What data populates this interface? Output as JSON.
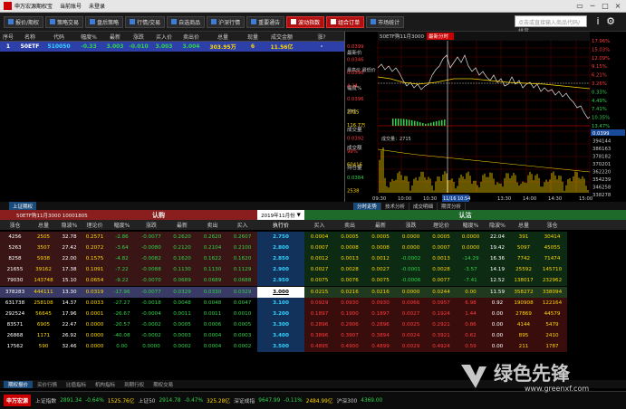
{
  "window": {
    "title": "申万宏源期权宝",
    "account": "当前账号",
    "user": "未登录",
    "controls": [
      "▭",
      "─",
      "□",
      "×"
    ]
  },
  "toolbar": [
    {
      "label": "报价/期权",
      "red": false
    },
    {
      "label": "策略交易",
      "red": false
    },
    {
      "label": "盘后策略",
      "red": false
    },
    {
      "label": "行情/交易",
      "red": false
    },
    {
      "label": "自选商品",
      "red": false
    },
    {
      "label": "沪深行情",
      "red": false
    },
    {
      "label": "重要通告",
      "red": false
    },
    {
      "label": "波动指数",
      "red": true
    },
    {
      "label": "组合订单",
      "red": true
    },
    {
      "label": "市场统计",
      "red": false
    }
  ],
  "search": {
    "placeholder": "点击或直接输入商品代码/拼音"
  },
  "toolbar_icons": [
    "i",
    "⚙"
  ],
  "etf": {
    "headers": [
      "序号",
      "名称",
      "代码",
      "幅度%",
      "最新",
      "涨跌",
      "买入价",
      "卖出价",
      "总量",
      "现量",
      "成交金额",
      "涨?"
    ],
    "row": [
      "1",
      "50ETF",
      "510050",
      "-0.33",
      "3.003",
      "-0.010",
      "3.003",
      "3.004",
      "303.95万",
      "6",
      "11.56亿",
      "-"
    ]
  },
  "chart": {
    "title": "50ETF购11月3000",
    "title2": "最新分时",
    "latest": "最新价",
    "hilo": "最高价 最低价",
    "avg_lbl": "均价",
    "vol_lbl": "成交量",
    "amt_lbl": "成交额",
    "pos_lbl": "持仓量",
    "vol_note": "成交量：2715",
    "change_lbl": "幅度%",
    "volume_val": "2715",
    "time_cursor": "11/16 10:54",
    "left_vals": [
      "0.0399",
      "0.0346",
      "0.0396",
      "4.24",
      "0.0396",
      "2715",
      "116.7万",
      "0.0392",
      "99%",
      "60416",
      "0.0384",
      "2538"
    ],
    "right_pct": [
      "17.96%",
      "15.03%",
      "12.09%",
      "9.15%",
      "6.21%",
      "3.26%",
      "0.33%",
      "4.49%",
      "7.41%",
      "10.35%",
      "13.47%"
    ],
    "right_vals": [
      "0.0399",
      "394144",
      "386163",
      "378182",
      "370201",
      "362220",
      "354239",
      "346258",
      "338278"
    ],
    "times": [
      "09:30",
      "10:00",
      "10:30",
      "11:16 10:54",
      "13:30",
      "14:00",
      "14:30",
      "15:00"
    ]
  },
  "tabs_right": [
    "分时走势",
    "技术分析",
    "成交明细",
    "期货分析"
  ],
  "mid_tab": "上证期权",
  "option": {
    "underlying_title": "50ETF购11月3000  10001805",
    "call_title": "认购",
    "put_title": "认沽",
    "month": "2019年11月份",
    "call_headers": [
      "涨仓",
      "总量",
      "隐波%",
      "理论价",
      "幅度%",
      "涨跌",
      "最新",
      "卖出",
      "买入"
    ],
    "strike_header": "执行价",
    "put_headers": [
      "买入",
      "卖出",
      "最新",
      "涨跌",
      "理论价",
      "幅度%",
      "隐波%",
      "总量",
      "涨仓"
    ],
    "rows": [
      {
        "c": [
          "4256",
          "2505",
          "32.78",
          "0.2571",
          "-2.86",
          "-0.0077",
          "0.2620",
          "0.2620",
          "0.2607"
        ],
        "k": "2.750",
        "p": [
          "0.0004",
          "0.0005",
          "0.0005",
          "0.0000",
          "0.0005",
          "0.0000",
          "22.04",
          "391",
          "30414"
        ]
      },
      {
        "c": [
          "5263",
          "3507",
          "27.42",
          "0.2072",
          "-3.64",
          "-0.0080",
          "0.2120",
          "0.2104",
          "0.2100"
        ],
        "k": "2.800",
        "p": [
          "0.0007",
          "0.0008",
          "0.0008",
          "0.0000",
          "0.0007",
          "0.0000",
          "19.42",
          "5097",
          "45055"
        ]
      },
      {
        "c": [
          "8258",
          "5938",
          "22.00",
          "0.1575",
          "-4.82",
          "-0.0082",
          "0.1620",
          "0.1622",
          "0.1620"
        ],
        "k": "2.850",
        "p": [
          "0.0012",
          "0.0013",
          "0.0012",
          "-0.0002",
          "0.0013",
          "-14.29",
          "16.36",
          "7742",
          "71474"
        ]
      },
      {
        "c": [
          "21655",
          "39162",
          "17.38",
          "0.1091",
          "-7.22",
          "-0.0088",
          "0.1130",
          "0.1130",
          "0.1129"
        ],
        "k": "2.900",
        "p": [
          "0.0027",
          "0.0028",
          "0.0027",
          "-0.0001",
          "0.0028",
          "-3.57",
          "14.19",
          "25592",
          "145710"
        ]
      },
      {
        "c": [
          "79030",
          "143748",
          "15.10",
          "0.0654",
          "-9.22",
          "-0.0070",
          "0.0689",
          "0.0689",
          "0.0688"
        ],
        "k": "2.950",
        "p": [
          "0.0075",
          "0.0076",
          "0.0075",
          "-0.0006",
          "0.0077",
          "-7.41",
          "12.52",
          "138017",
          "232962"
        ]
      },
      {
        "c": [
          "378283",
          "444111",
          "13.30",
          "0.0319",
          "-17.96",
          "-0.0077",
          "0.0329",
          "0.0330",
          "0.0329"
        ],
        "k": "3.000",
        "p": [
          "0.0215",
          "0.0216",
          "0.0216",
          "0.0000",
          "0.0244",
          "0.00",
          "11.59",
          "358272",
          "338094"
        ]
      },
      {
        "c": [
          "631738",
          "258108",
          "14.37",
          "0.0033",
          "-27.27",
          "-0.0018",
          "0.0048",
          "0.0048",
          "0.0047"
        ],
        "k": "3.100",
        "p": [
          "0.0929",
          "0.0930",
          "0.0930",
          "0.0066",
          "0.0957",
          "6.98",
          "0.92",
          "190908",
          "122164"
        ]
      },
      {
        "c": [
          "292524",
          "56645",
          "17.96",
          "0.0001",
          "-26.67",
          "-0.0004",
          "0.0011",
          "0.0011",
          "0.0010"
        ],
        "k": "3.200",
        "p": [
          "0.1897",
          "0.1900",
          "0.1897",
          "0.0027",
          "0.1924",
          "1.44",
          "0.00",
          "27869",
          "44579"
        ]
      },
      {
        "c": [
          "83571",
          "6905",
          "22.47",
          "0.0000",
          "-20.57",
          "-0.0002",
          "0.0005",
          "0.0006",
          "0.0005"
        ],
        "k": "3.300",
        "p": [
          "0.2896",
          "0.2906",
          "0.2896",
          "0.0025",
          "0.2921",
          "0.86",
          "0.00",
          "4144",
          "5479"
        ],
        "dash": true
      },
      {
        "c": [
          "26868",
          "1171",
          "26.92",
          "0.0000",
          "-40.08",
          "-0.0002",
          "0.0003",
          "0.0004",
          "0.0003"
        ],
        "k": "3.400",
        "p": [
          "0.3896",
          "0.3907",
          "0.3894",
          "0.0024",
          "0.3921",
          "0.62",
          "0.00",
          "895",
          "2410"
        ]
      },
      {
        "c": [
          "17562",
          "590",
          "32.46",
          "0.0000",
          "0.00",
          "0.0000",
          "0.0002",
          "0.0004",
          "0.0002"
        ],
        "k": "3.500",
        "p": [
          "0.4895",
          "0.4900",
          "0.4899",
          "0.0029",
          "0.4924",
          "0.59",
          "0.00",
          "211",
          "1787"
        ]
      }
    ]
  },
  "bottom_tabs": [
    "期权报价",
    "买价行情",
    "比值指标",
    "机构指标",
    "到期行权",
    "期权交易"
  ],
  "status": {
    "brand": "申万宏源",
    "sh_name": "上证指数",
    "sh_val": "2891.34",
    "sh_pct": "-0.64%",
    "sh_vol": "1525.76亿",
    "b50_name": "上证50",
    "b50_val": "2914.78",
    "b50_pct": "-0.47%",
    "b50_vol": "325.28亿",
    "sz_name": "深证成指",
    "sz_val": "9647.99",
    "sz_pct": "-0.11%",
    "sz_vol": "2484.99亿",
    "h300_name": "沪深300",
    "h300_val": "4369.00"
  },
  "watermark": {
    "cn": "绿色先锋",
    "url": "www.greenxf.com"
  },
  "colors": {
    "red": "#ff3b3b",
    "green": "#2fd34a",
    "yellow": "#ffd700",
    "white": "#ffffff",
    "cyan": "#35d3ff",
    "callbar": "#8a1d1d",
    "putbar": "#1d6a2a",
    "strike": "#12325c"
  }
}
